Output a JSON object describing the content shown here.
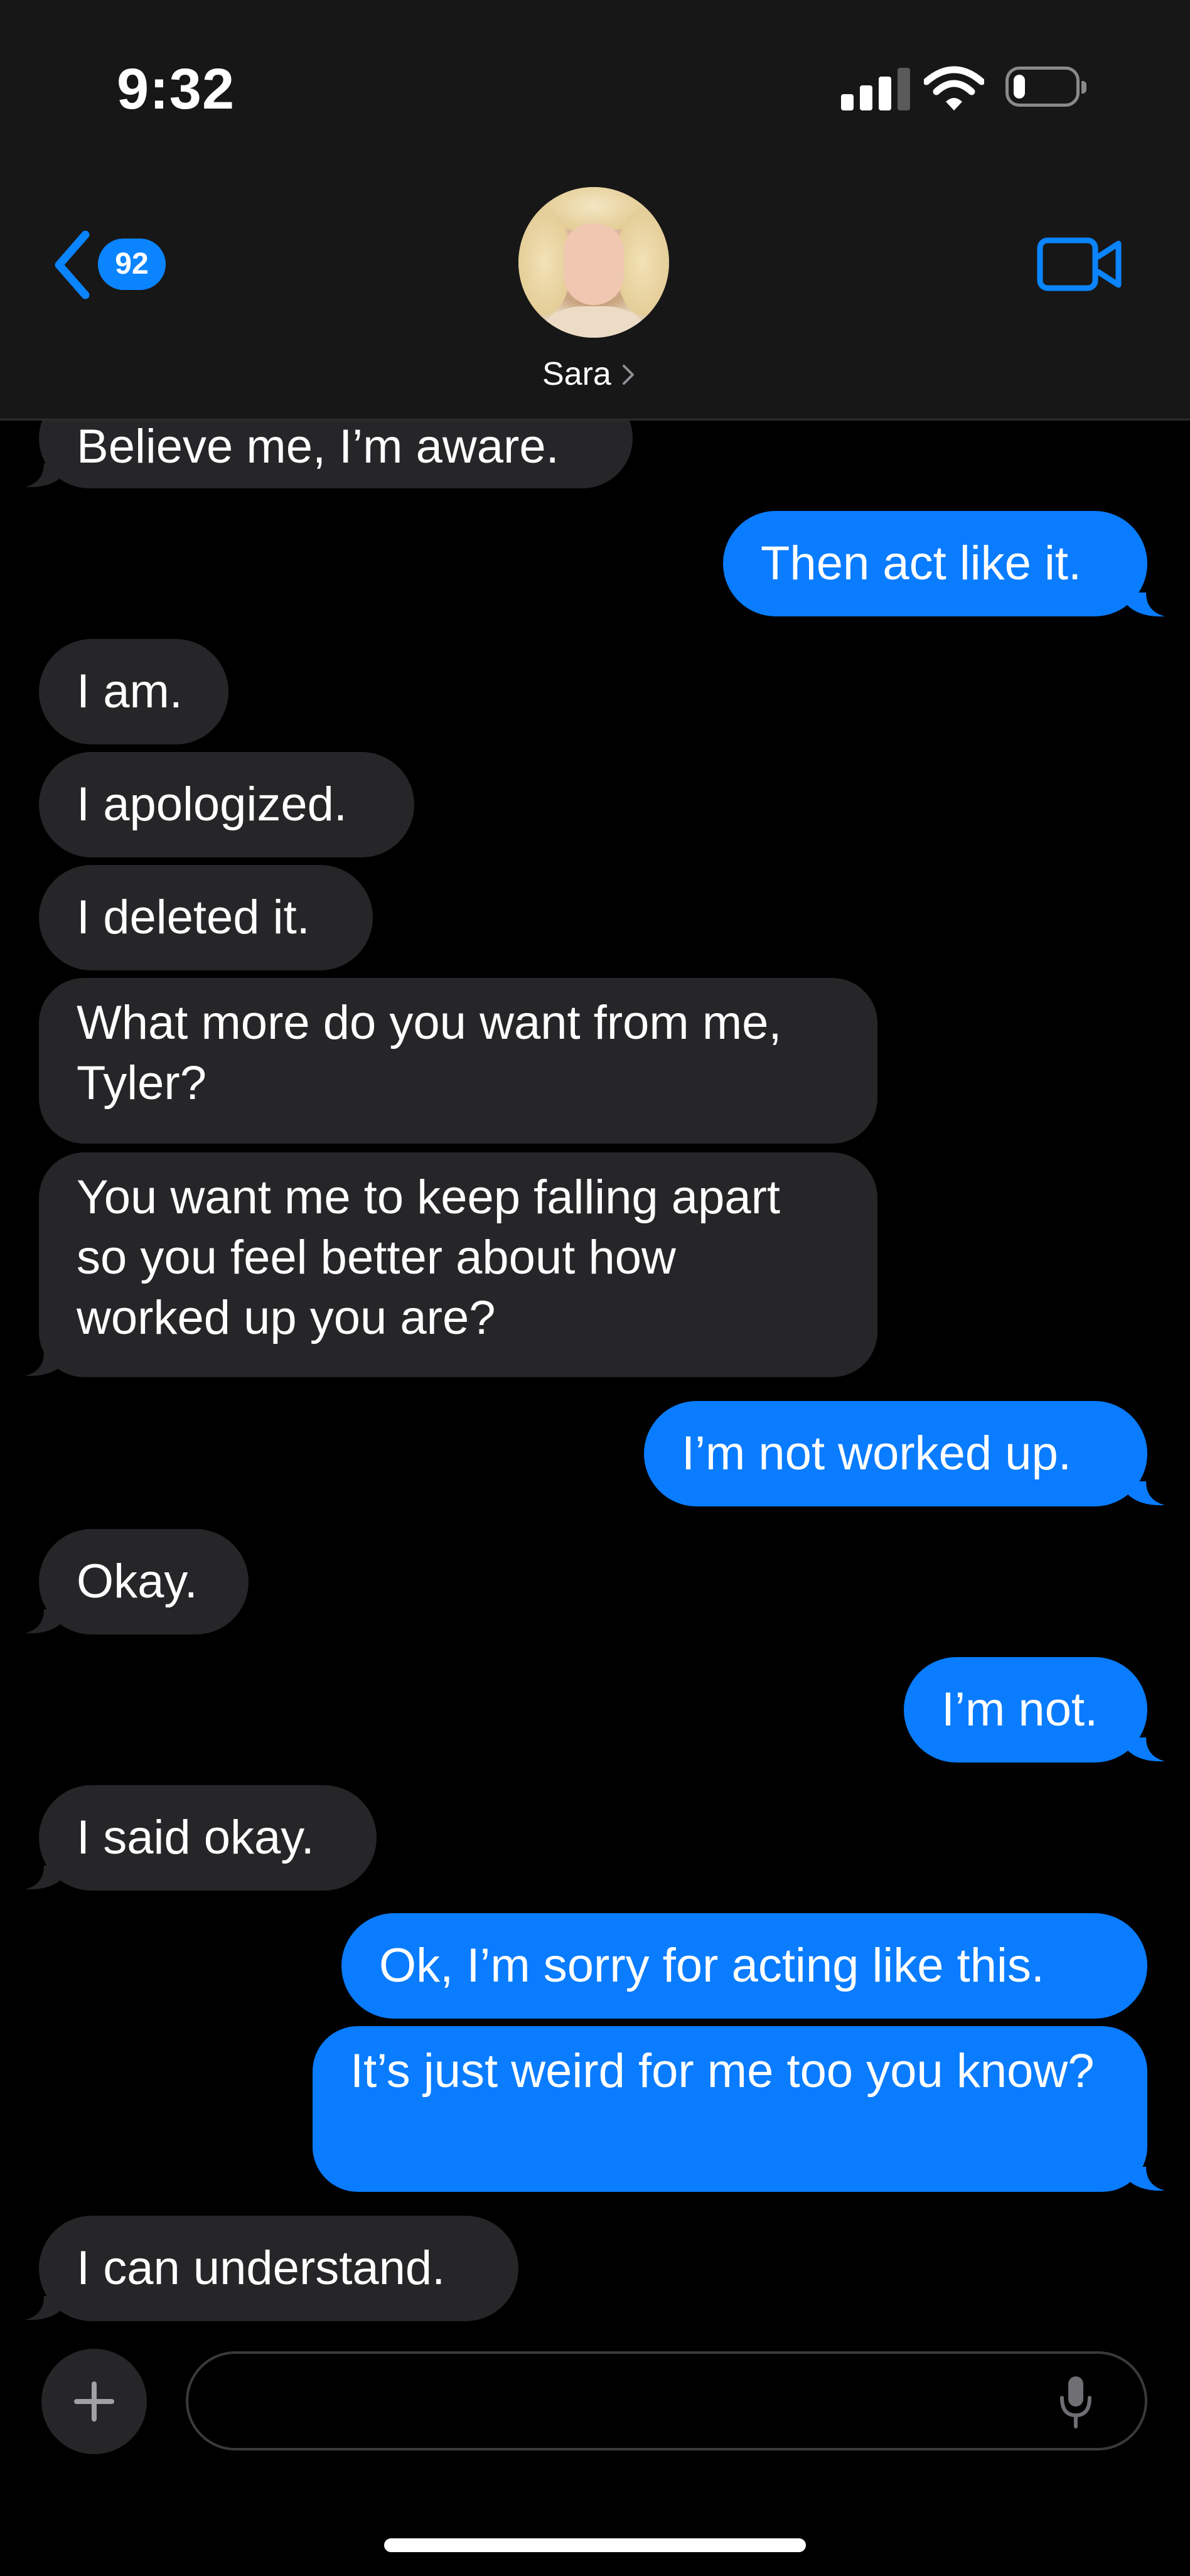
{
  "status_bar": {
    "time": "9:32",
    "battery_level": 0.2
  },
  "nav": {
    "back_badge": "92",
    "contact_name": "Sara"
  },
  "messages": [
    {
      "from": "them",
      "text": "Believe me, I’m aware."
    },
    {
      "from": "me",
      "text": "Then act like it."
    },
    {
      "from": "them",
      "text": "I am."
    },
    {
      "from": "them",
      "text": "I apologized."
    },
    {
      "from": "them",
      "text": "I deleted it."
    },
    {
      "from": "them",
      "text": "What more do you want from me, Tyler?"
    },
    {
      "from": "them",
      "text": "You want me to keep falling apart so you feel better about how worked up you are?"
    },
    {
      "from": "me",
      "text": "I’m not worked up."
    },
    {
      "from": "them",
      "text": "Okay."
    },
    {
      "from": "me",
      "text": "I’m not."
    },
    {
      "from": "them",
      "text": "I said okay."
    },
    {
      "from": "me",
      "text": "Ok, I’m sorry for acting like this."
    },
    {
      "from": "me",
      "text": "It’s just weird for me too you know?"
    },
    {
      "from": "them",
      "text": "I can understand."
    }
  ],
  "composer": {
    "value": "",
    "placeholder": ""
  },
  "colors": {
    "sent_bubble": "#0a7cff",
    "received_bubble": "#262628",
    "accent": "#0a84ff",
    "header_bg": "#171717"
  },
  "icons": {
    "back": "chevron-left-icon",
    "video": "video-camera-icon",
    "plus": "plus-icon",
    "mic": "microphone-icon",
    "signal": "cellular-signal-icon",
    "wifi": "wifi-icon",
    "battery": "battery-icon"
  }
}
